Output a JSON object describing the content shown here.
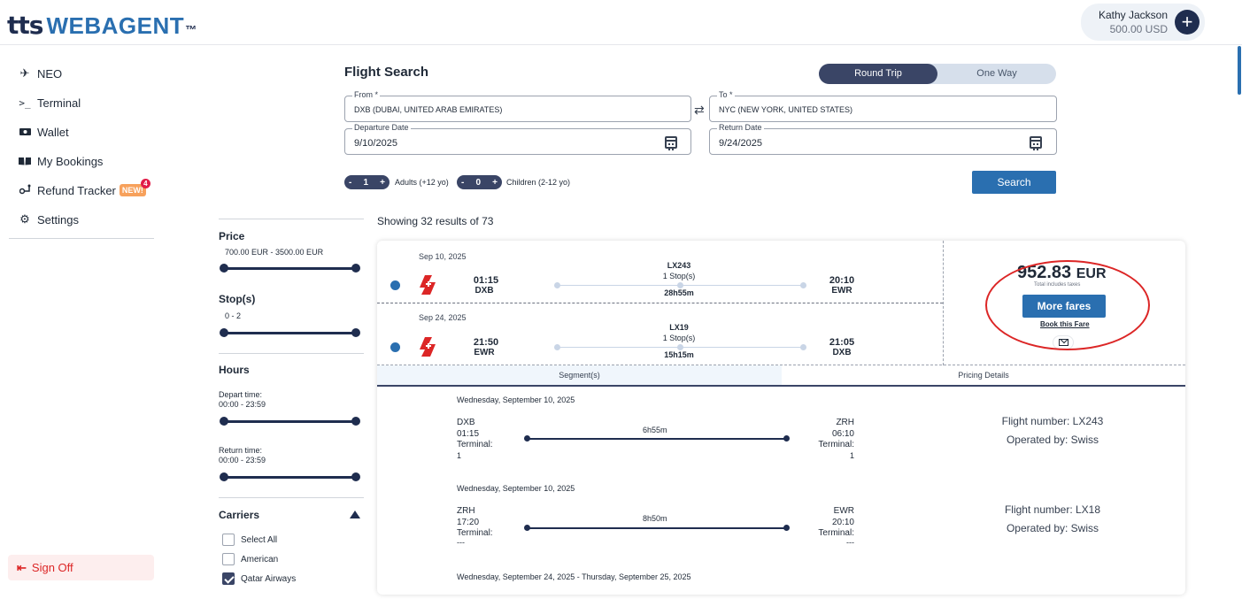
{
  "brand": {
    "logo_tts": "tts",
    "logo_web": "WEBAGENT",
    "logo_tm": "™"
  },
  "user": {
    "name": "Kathy Jackson",
    "balance": "500.00 USD",
    "add_icon": "+"
  },
  "sidebar": {
    "items": [
      {
        "label": "NEO",
        "icon": "plane-icon"
      },
      {
        "label": "Terminal",
        "icon": "terminal-icon"
      },
      {
        "label": "Wallet",
        "icon": "wallet-icon"
      },
      {
        "label": "My Bookings",
        "icon": "book-icon"
      },
      {
        "label": "Refund Tracker",
        "icon": "refund-icon",
        "badge": "NEW!",
        "count": "4"
      },
      {
        "label": "Settings",
        "icon": "gear-icon"
      }
    ],
    "signoff": "Sign Off"
  },
  "search": {
    "title": "Flight Search",
    "trip_round": "Round Trip",
    "trip_oneway": "One Way",
    "from_label": "From *",
    "from_value": "DXB (DUBAI, UNITED ARAB EMIRATES)",
    "to_label": "To *",
    "to_value": "NYC (NEW YORK, UNITED STATES)",
    "depart_label": "Departure Date",
    "depart_value": "9/10/2025",
    "return_label": "Return Date",
    "return_value": "9/24/2025",
    "adults_count": "1",
    "adults_label": "Adults (+12 yo)",
    "children_count": "0",
    "children_label": "Children (2-12 yo)",
    "minus": "-",
    "plus": "+",
    "search_button": "Search"
  },
  "filters": {
    "price_heading": "Price",
    "price_range": "700.00 EUR - 3500.00 EUR",
    "stops_heading": "Stop(s)",
    "stops_range": "0 - 2",
    "hours_heading": "Hours",
    "depart_time_label": "Depart time:",
    "depart_time_range": "00:00 - 23:59",
    "return_time_label": "Return time:",
    "return_time_range": "00:00 - 23:59",
    "carriers_heading": "Carriers",
    "carriers": [
      {
        "label": "Select All",
        "checked": false
      },
      {
        "label": "American",
        "checked": false
      },
      {
        "label": "Qatar Airways",
        "checked": true
      }
    ]
  },
  "results": {
    "count_text": "Showing 32 results of 73",
    "legs": [
      {
        "date": "Sep 10, 2025",
        "dep_time": "01:15",
        "dep_code": "DXB",
        "flight": "LX243",
        "stops": "1 Stop(s)",
        "duration": "28h55m",
        "arr_time": "20:10",
        "arr_code": "EWR"
      },
      {
        "date": "Sep 24, 2025",
        "dep_time": "21:50",
        "dep_code": "EWR",
        "flight": "LX19",
        "stops": "1 Stop(s)",
        "duration": "15h15m",
        "arr_time": "21:05",
        "arr_code": "DXB"
      }
    ],
    "price_amount": "952.83",
    "price_currency": "EUR",
    "price_note": "Total includes taxes",
    "more_fares": "More fares",
    "book_fare": "Book this Fare",
    "tab_segments": "Segment(s)",
    "tab_pricing": "Pricing Details",
    "segments": [
      {
        "date": "Wednesday, September 10, 2025",
        "from": "DXB",
        "dep": "01:15",
        "from_terminal_label": "Terminal:",
        "from_terminal": "1",
        "duration": "6h55m",
        "to": "ZRH",
        "arr": "06:10",
        "to_terminal_label": "Terminal:",
        "to_terminal": "1",
        "flight_number": "Flight number: LX243",
        "operated_by": "Operated by: Swiss"
      },
      {
        "date": "Wednesday, September 10, 2025",
        "from": "ZRH",
        "dep": "17:20",
        "from_terminal_label": "Terminal:",
        "from_terminal": "---",
        "duration": "8h50m",
        "to": "EWR",
        "arr": "20:10",
        "to_terminal_label": "Terminal:",
        "to_terminal": "---",
        "flight_number": "Flight number: LX18",
        "operated_by": "Operated by: Swiss"
      }
    ],
    "return_segment_date": "Wednesday, September 24, 2025 - Thursday, September 25, 2025"
  }
}
